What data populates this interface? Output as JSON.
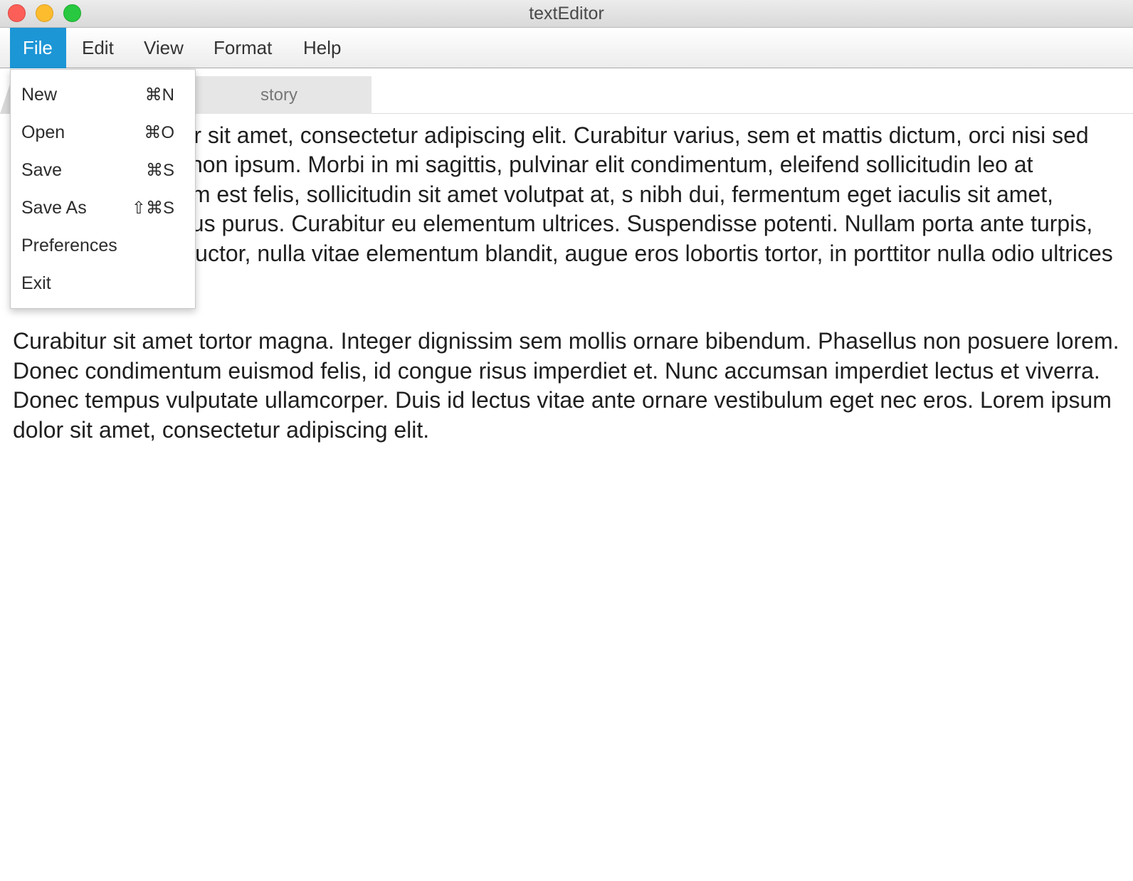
{
  "window": {
    "title": "textEditor",
    "controls": [
      "close",
      "minimize",
      "maximize"
    ]
  },
  "menubar": {
    "items": [
      "File",
      "Edit",
      "View",
      "Format",
      "Help"
    ],
    "active": "File"
  },
  "file_menu": {
    "items": [
      {
        "label": "New",
        "shortcut": "⌘N"
      },
      {
        "label": "Open",
        "shortcut": "⌘O"
      },
      {
        "label": "Save",
        "shortcut": "⌘S"
      },
      {
        "label": "Save As",
        "shortcut": "⇧⌘S"
      },
      {
        "label": "Preferences",
        "shortcut": ""
      },
      {
        "label": "Exit",
        "shortcut": ""
      }
    ]
  },
  "tabs": [
    {
      "label": "story"
    }
  ],
  "document": {
    "paragraphs": [
      "Lorem ipsum dolor sit amet, consectetur adipiscing elit. Curabitur varius, sem et mattis dictum, orci nisi sed facilisis orci justo non ipsum. Morbi in mi sagittis, pulvinar elit condimentum, eleifend sollicitudin leo at accumsan. Aliquam est felis, sollicitudin sit amet volutpat at, s nibh dui, fermentum eget iaculis sit amet, scelerisque rhoncus purus. Curabitur eu elementum ultrices. Suspendisse potenti. Nullam porta ante turpis, quis luctus leo n auctor, nulla vitae elementum blandit, augue eros lobortis tortor, in porttitor nulla odio ultrices justo.",
      "Curabitur sit amet tortor magna. Integer dignissim sem mollis ornare bibendum. Phasellus non posuere lorem. Donec condimentum euismod felis, id congue risus imperdiet et. Nunc accumsan imperdiet lectus et viverra. Donec tempus vulputate ullamcorper. Duis id lectus vitae ante ornare vestibulum eget nec eros. Lorem ipsum dolor sit amet, consectetur adipiscing elit."
    ]
  },
  "colors": {
    "menu_active": "#1d96d6",
    "close_button": "#fc5f57",
    "minimize_button": "#fdbc2e",
    "maximize_button": "#28c840"
  }
}
